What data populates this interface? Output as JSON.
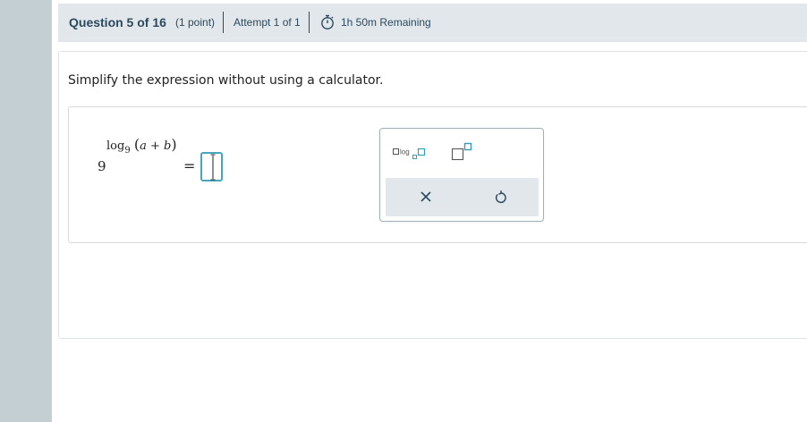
{
  "header": {
    "question_label": "Question 5 of 16",
    "points": "(1 point)",
    "attempt": "Attempt 1 of 1",
    "time_remaining": "1h 50m Remaining",
    "timer_icon": "stopwatch-icon"
  },
  "question": {
    "prompt": "Simplify the expression without using a calculator."
  },
  "expression": {
    "base": "9",
    "exp_log": "log",
    "exp_log_base": "9",
    "exp_open": "(",
    "exp_var_a": "a",
    "exp_plus": " + ",
    "exp_var_b": "b",
    "exp_close": ")",
    "equals": "="
  },
  "answer": {
    "value": ""
  },
  "palette": {
    "buttons": [
      "log-base-template-icon",
      "exponent-template-icon"
    ],
    "actions": [
      "clear-icon",
      "undo-icon"
    ],
    "accent": "#2e9fb8"
  },
  "colors": {
    "header_bg": "#e1e7ea",
    "header_text": "#2c4a5f",
    "rail": "#c4cfd4",
    "input_border": "#47a6bd"
  }
}
